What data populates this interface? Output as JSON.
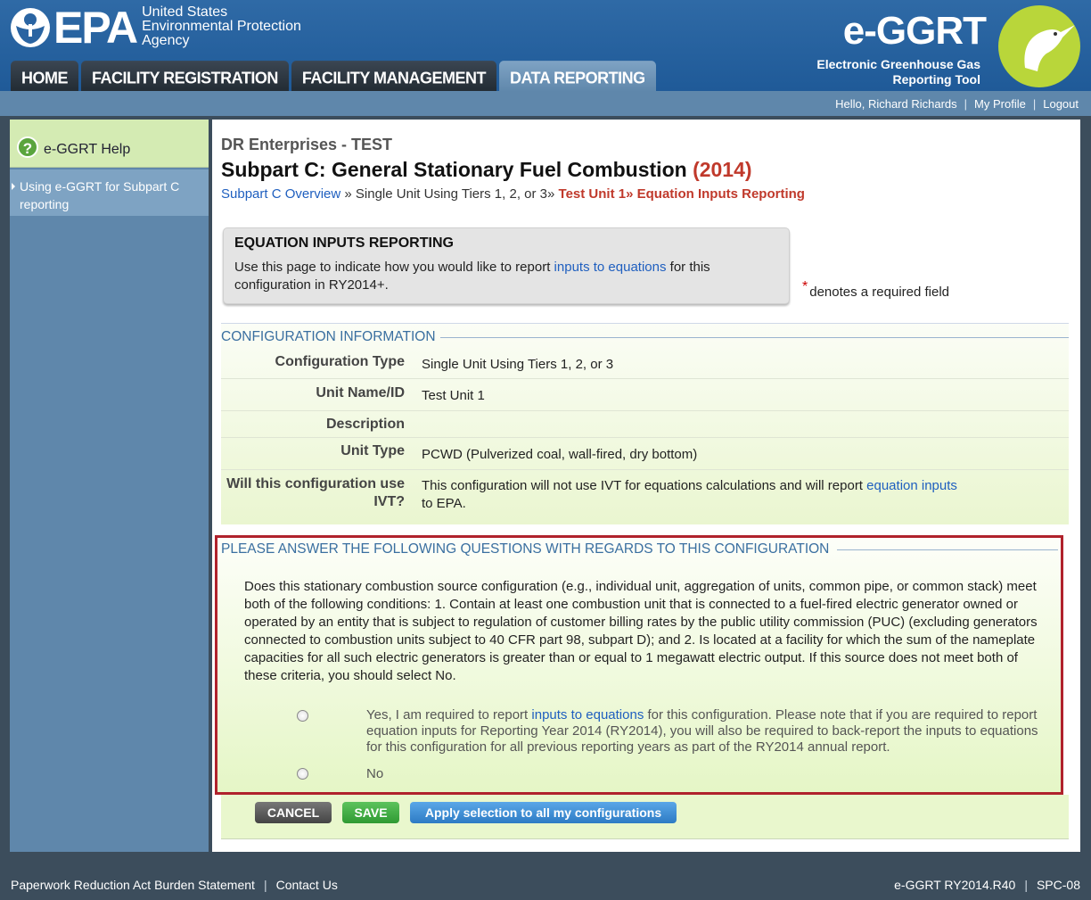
{
  "header": {
    "epa_letters": "EPA",
    "agency_line1": "United States",
    "agency_line2": "Environmental Protection",
    "agency_line3": "Agency",
    "app_logo": "e-GGRT",
    "app_sub1": "Electronic Greenhouse Gas",
    "app_sub2": "Reporting Tool"
  },
  "tabs": [
    {
      "label": "HOME"
    },
    {
      "label": "FACILITY REGISTRATION"
    },
    {
      "label": "FACILITY MANAGEMENT"
    },
    {
      "label": "DATA REPORTING",
      "active": true
    }
  ],
  "userbar": {
    "greeting": "Hello, Richard Richards",
    "profile": "My Profile",
    "logout": "Logout"
  },
  "sidebar": {
    "help_title": "e-GGRT Help",
    "help_icon": "question-icon",
    "link": "Using e-GGRT for Subpart C reporting"
  },
  "main": {
    "company": "DR Enterprises - TEST",
    "title": "Subpart C: General Stationary Fuel Combustion",
    "year": "(2014)",
    "breadcrumb": {
      "overview": "Subpart C Overview",
      "sep": "»",
      "single": "Single Unit Using Tiers 1, 2, or 3",
      "unit": "Test Unit 1",
      "current": "Equation Inputs Reporting"
    },
    "info_box": {
      "heading": "EQUATION INPUTS REPORTING",
      "text_before": "Use this page to indicate how you would like to report ",
      "link": "inputs to equations",
      "text_after": " for this configuration in RY2014+."
    },
    "required_note": "denotes a required field",
    "config": {
      "heading": "CONFIGURATION INFORMATION",
      "type_label": "Configuration Type",
      "type_value": "Single Unit Using Tiers 1, 2, or 3",
      "name_label": "Unit Name/ID",
      "name_value": "Test Unit 1",
      "desc_label": "Description",
      "desc_value": "",
      "unit_type_label": "Unit Type",
      "unit_type_value": "PCWD (Pulverized coal, wall-fired, dry bottom)",
      "ivt_label_1": "Will this configuration use",
      "ivt_label_2": "IVT?",
      "ivt_value_before": "This configuration will not use IVT for equations calculations and will report ",
      "ivt_link": "equation inputs",
      "ivt_value_after": "to EPA."
    },
    "questions": {
      "heading": "PLEASE ANSWER THE FOLLOWING QUESTIONS WITH REGARDS TO THIS CONFIGURATION",
      "question": "Does this stationary combustion source configuration (e.g., individual unit, aggregation of units, common pipe, or common stack) meet both of the following conditions: 1. Contain at least one combustion unit that is connected to a fuel-fired electric generator owned or operated by an entity that is subject to regulation of customer billing rates by the public utility commission (PUC) (excluding generators connected to combustion units subject to 40 CFR part 98, subpart D); and 2. Is located at a facility for which the sum of the nameplate capacities for all such electric generators is greater than or equal to 1 megawatt electric output. If this source does not meet both of these criteria, you should select No.",
      "yes_before": "Yes, I am required to report ",
      "yes_link": "inputs to equations",
      "yes_after": " for this configuration. Please note that if you are required to report equation inputs for Reporting Year 2014 (RY2014), you will also be required to back-report the inputs to equations for this configuration for all previous reporting years as part of the RY2014 annual report.",
      "no_label": "No"
    },
    "buttons": {
      "cancel": "CANCEL",
      "save": "SAVE",
      "apply": "Apply selection to all my configurations"
    }
  },
  "footer": {
    "paperwork": "Paperwork Reduction Act Burden Statement",
    "contact": "Contact Us",
    "version": "e-GGRT RY2014.R40",
    "code": "SPC-08"
  }
}
